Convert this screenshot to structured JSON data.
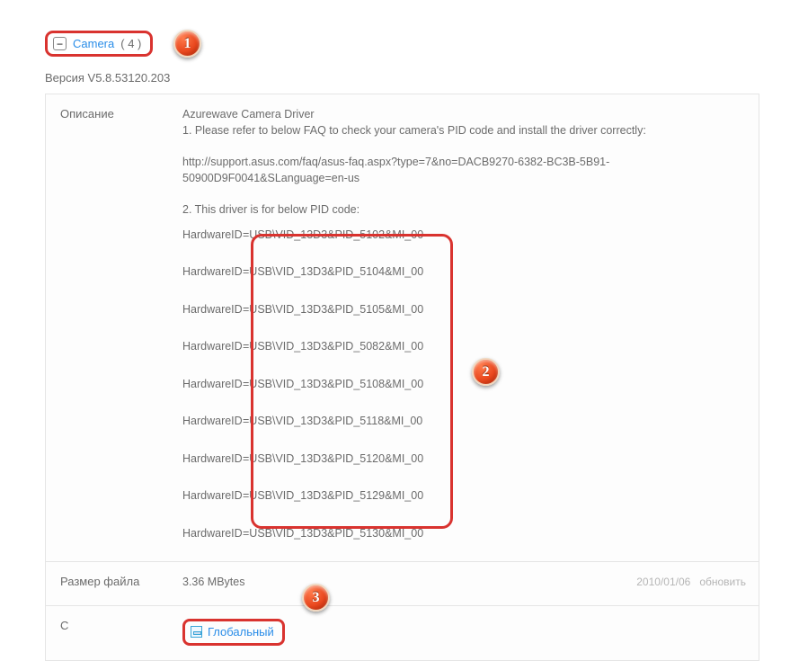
{
  "category": {
    "name": "Camera",
    "count": "( 4 )"
  },
  "version_line": "Версия V5.8.53120.203",
  "labels": {
    "description": "Описание",
    "filesize": "Размер файла",
    "from": "С"
  },
  "description": {
    "title": "Azurewave Camera Driver",
    "line1": "1. Please refer to below FAQ to check your camera's PID code and install the driver correctly:",
    "faq_url": "http://support.asus.com/faq/asus-faq.aspx?type=7&no=DACB9270-6382-BC3B-5B91-50900D9F0041&SLanguage=en-us",
    "line2": "2. This driver is for below PID code:",
    "hw_prefix": "HardwareID",
    "hw_ids": [
      "=USB\\VID_13D3&PID_5102&MI_00",
      "=USB\\VID_13D3&PID_5104&MI_00",
      "=USB\\VID_13D3&PID_5105&MI_00",
      "=USB\\VID_13D3&PID_5082&MI_00",
      "=USB\\VID_13D3&PID_5108&MI_00",
      "=USB\\VID_13D3&PID_5118&MI_00",
      "=USB\\VID_13D3&PID_5120&MI_00",
      "=USB\\VID_13D3&PID_5129&MI_00",
      "=USB\\VID_13D3&PID_5130&MI_00"
    ]
  },
  "filesize": {
    "value": "3.36 MBytes",
    "date": "2010/01/06",
    "update_word": "обновить"
  },
  "download": {
    "label": "Глобальный"
  },
  "callouts": {
    "c1": "1",
    "c2": "2",
    "c3": "3"
  }
}
